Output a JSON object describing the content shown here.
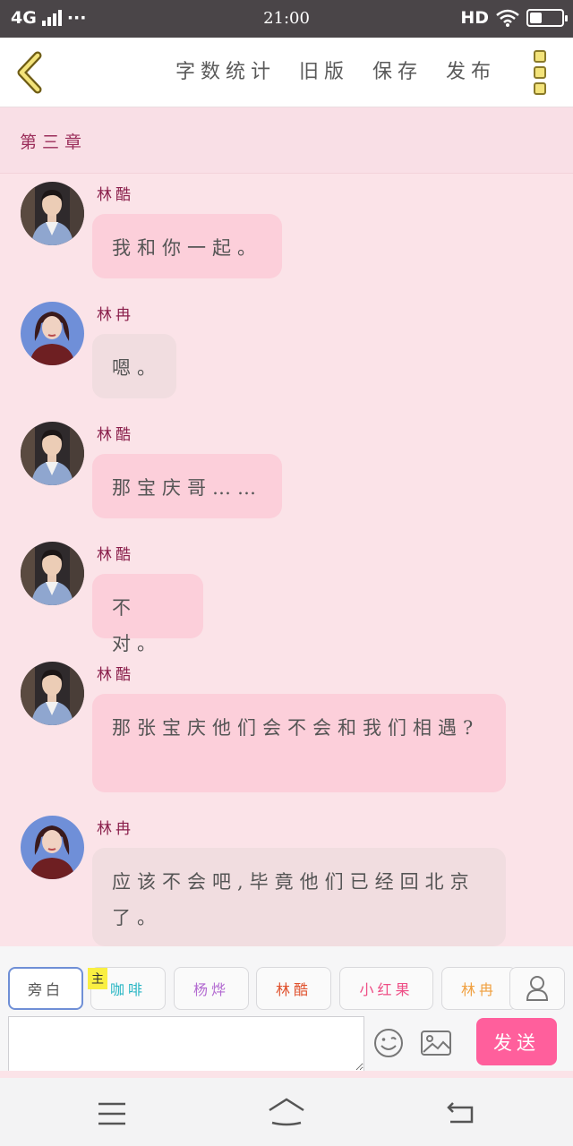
{
  "status_bar": {
    "network": "4G",
    "dots": "···",
    "time": "21:00",
    "hd": "HD",
    "battery_level": 0.35
  },
  "toolbar": {
    "back_icon": "chevron-left-icon",
    "actions": [
      "字数统计",
      "旧版",
      "保存",
      "发布"
    ],
    "more_icon": "more-vertical-icon"
  },
  "chapter": {
    "title": "第三章"
  },
  "messages": [
    {
      "name": "林酷",
      "text": "我和你一起。",
      "avatar": "male",
      "style": "pink"
    },
    {
      "name": "林冉",
      "text": "嗯。",
      "avatar": "female",
      "style": "gray"
    },
    {
      "name": "林酷",
      "text": "那宝庆哥……",
      "avatar": "male",
      "style": "pink"
    },
    {
      "name": "林酷",
      "text": "不对。",
      "avatar": "male",
      "style": "pink"
    },
    {
      "name": "林酷",
      "text": "那张宝庆他们会不会和我们相遇?",
      "avatar": "male",
      "style": "pink"
    },
    {
      "name": "林冉",
      "text": "应该不会吧,毕竟他们已经回北京了。",
      "avatar": "female",
      "style": "gray"
    }
  ],
  "roles": [
    {
      "label": "旁白",
      "color": "#555555",
      "active": true
    },
    {
      "label": "咖啡",
      "color": "#29b6c4",
      "active": false,
      "tag": "主"
    },
    {
      "label": "杨烨",
      "color": "#b36bd1",
      "active": false
    },
    {
      "label": "林酷",
      "color": "#e0522e",
      "active": false
    },
    {
      "label": "小红果",
      "color": "#ee4f86",
      "active": false
    },
    {
      "label": "林冉",
      "color": "#f0a040",
      "active": false
    }
  ],
  "input": {
    "value": "",
    "placeholder": "",
    "send_label": "发送",
    "emoji_icon": "emoji-icon",
    "image_icon": "image-icon",
    "user_icon": "user-icon"
  },
  "navbar": {
    "icons": [
      "menu-icon",
      "home-icon",
      "back-icon"
    ]
  }
}
